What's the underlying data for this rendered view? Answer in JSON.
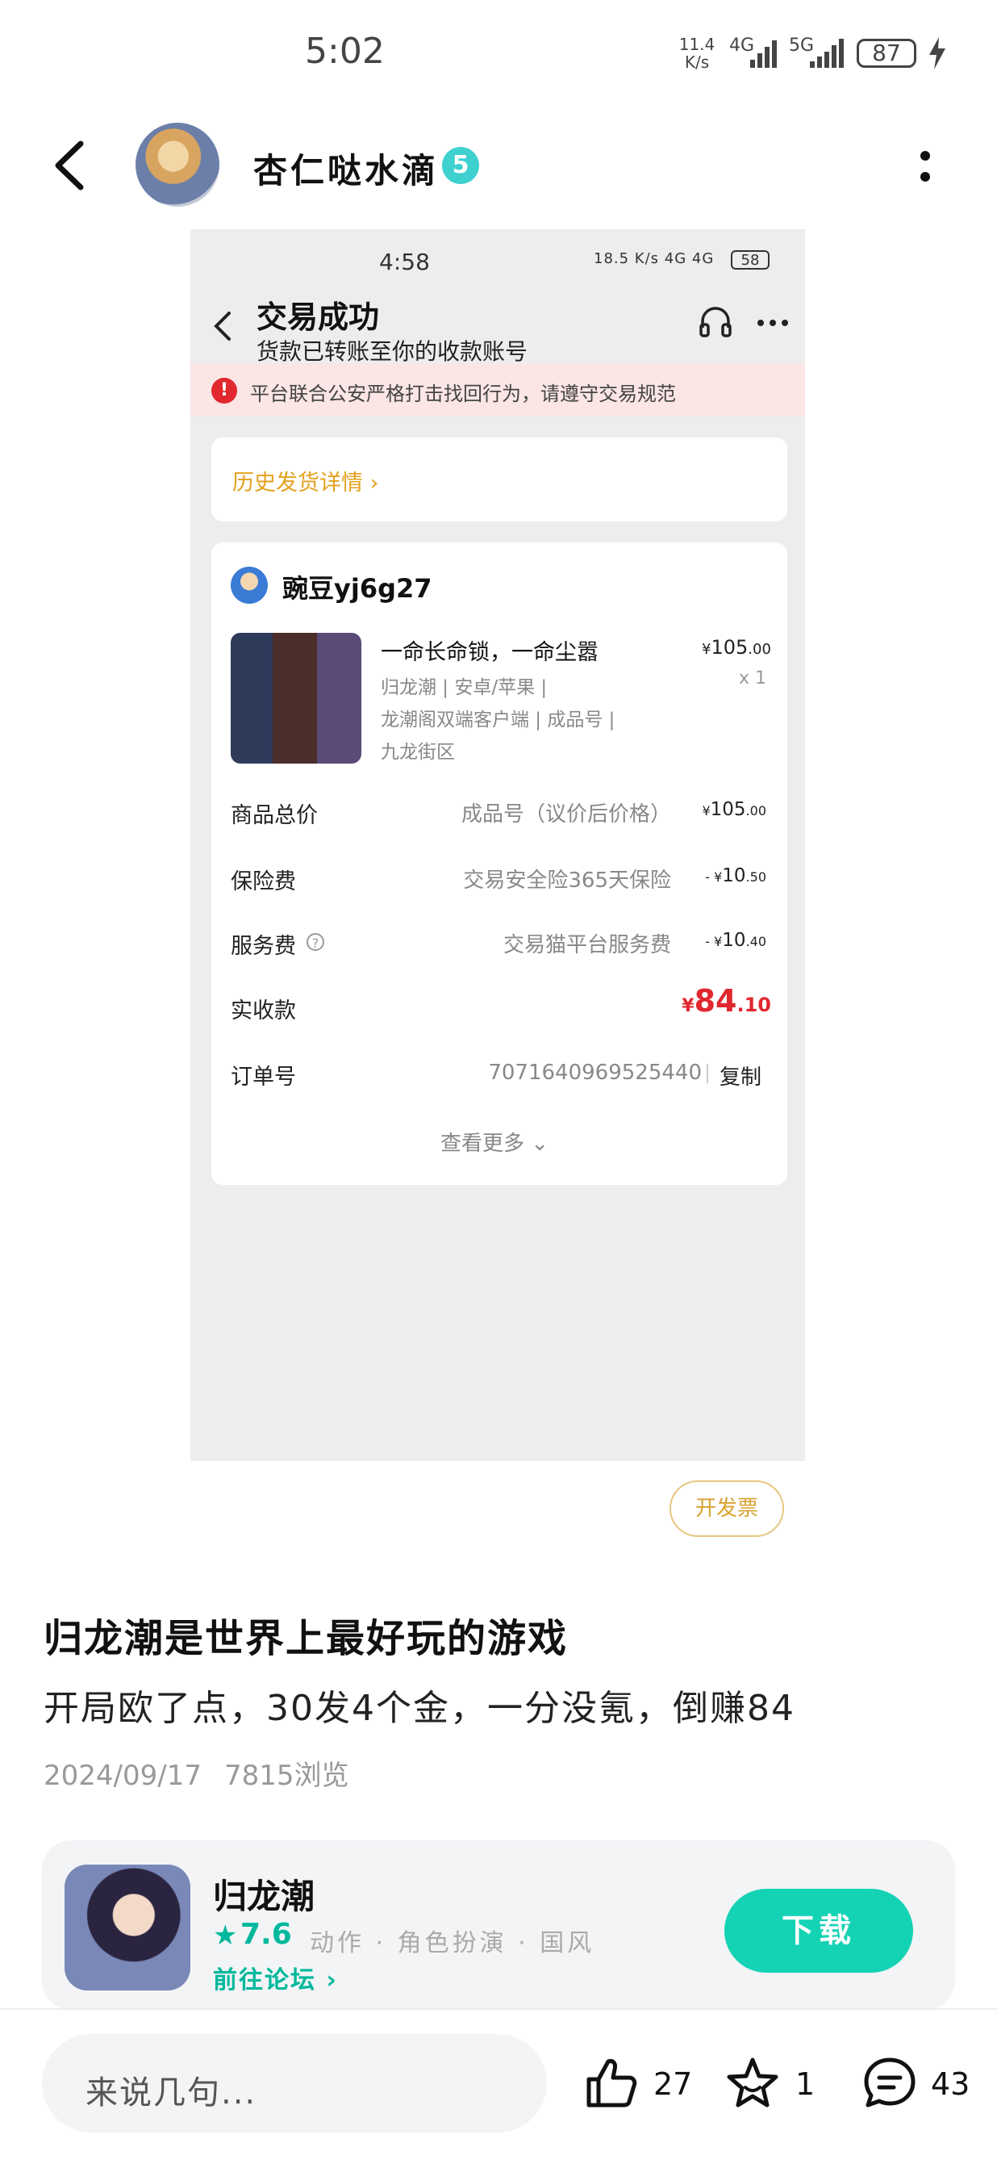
{
  "status_bar": {
    "time": "5:02",
    "net_speed_value": "11.4",
    "net_speed_unit": "K/s",
    "signal_a": "4G",
    "signal_b": "5G",
    "battery": "87"
  },
  "header": {
    "author": "杏仁哒水滴",
    "level_badge": "5"
  },
  "screenshot": {
    "time": "4:58",
    "status_icons": "18.5 K/s  4G  4G",
    "battery": "58",
    "title": "交易成功",
    "subtitle": "货款已转账至你的收款账号",
    "warning": "平台联合公安严格打击找回行为，请遵守交易规范",
    "history_link": "历史发货详情",
    "seller": "豌豆yj6g27",
    "product": {
      "title": "一命长命锁，一命尘嚣",
      "price_int": "105",
      "price_dec": ".00",
      "qty": "x 1",
      "tag_line1": "归龙潮 | 安卓/苹果 |",
      "tag_line2": "龙潮阁双端客户端 | 成品号 |",
      "tag_line3": "九龙街区"
    },
    "rows": {
      "total_label": "商品总价",
      "total_desc": "成品号（议价后价格）",
      "total_int": "105",
      "total_dec": ".00",
      "insurance_label": "保险费",
      "insurance_desc": "交易安全险365天保险",
      "insurance_int": "10",
      "insurance_dec": ".50",
      "service_label": "服务费",
      "service_desc": "交易猫平台服务费",
      "service_int": "10",
      "service_dec": ".40",
      "net_label": "实收款",
      "net_int": "84",
      "net_dec": ".10",
      "order_label": "订单号",
      "order_no": "7071640969525440",
      "copy": "复制",
      "see_more": "查看更多"
    }
  },
  "invoice_button": "开发票",
  "post": {
    "title": "归龙潮是世界上最好玩的游戏",
    "body": "开局欧了点，30发4个金，一分没氪，倒赚84",
    "date": "2024/09/17",
    "views": "7815浏览"
  },
  "game_card": {
    "name": "归龙潮",
    "rating": "7.6",
    "tags": "动作 · 角色扮演 · 国风",
    "forum_link": "前往论坛",
    "download": "下载"
  },
  "bottom_bar": {
    "comment_placeholder": "来说几句...",
    "likes": "27",
    "favorites": "1",
    "comments": "43"
  },
  "colors": {
    "accent_teal": "#14d3b4",
    "warning_red": "#e0282e",
    "gold": "#e4a11e"
  }
}
